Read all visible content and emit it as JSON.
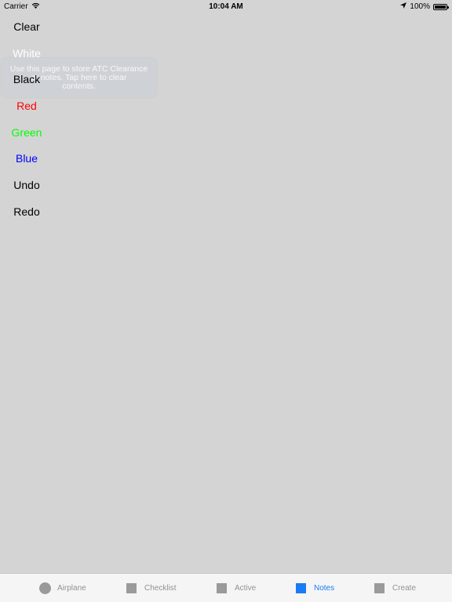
{
  "status_bar": {
    "carrier": "Carrier",
    "time": "10:04 AM",
    "battery": "100%"
  },
  "tooltip": {
    "line1": "Use this page to store ATC Clearance",
    "line2": "or notes. Tap here to clear",
    "line3": "contents."
  },
  "menu": {
    "items": [
      {
        "label": "Clear",
        "color": "#000000"
      },
      {
        "label": "White",
        "color": "#ffffff"
      },
      {
        "label": "Black",
        "color": "#000000"
      },
      {
        "label": "Red",
        "color": "#ff0000"
      },
      {
        "label": "Green",
        "color": "#00ff00"
      },
      {
        "label": "Blue",
        "color": "#0000ff"
      },
      {
        "label": "Undo",
        "color": "#000000"
      },
      {
        "label": "Redo",
        "color": "#000000"
      }
    ]
  },
  "tab_bar": {
    "accent_color": "#1a7cf5",
    "tabs": [
      {
        "label": "Airplane",
        "icon": "circle-icon"
      },
      {
        "label": "Checklist",
        "icon": "square-icon"
      },
      {
        "label": "Active",
        "icon": "square-icon"
      },
      {
        "label": "Notes",
        "icon": "square-icon",
        "selected": true
      },
      {
        "label": "Create",
        "icon": "square-icon"
      }
    ]
  }
}
